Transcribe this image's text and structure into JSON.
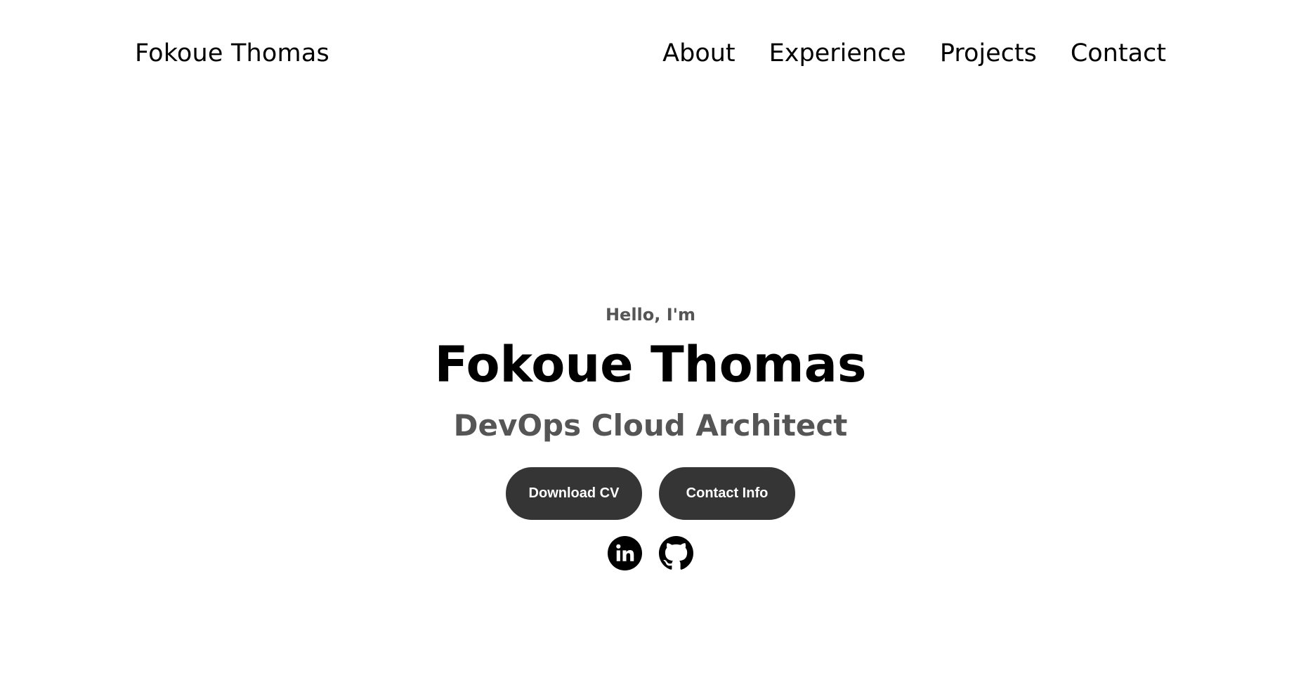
{
  "nav": {
    "logo": "Fokoue Thomas",
    "links": [
      "About",
      "Experience",
      "Projects",
      "Contact"
    ]
  },
  "hero": {
    "greeting": "Hello, I'm",
    "title": "Fokoue Thomas",
    "subtitle": "DevOps Cloud Architect",
    "buttons": {
      "download_cv": "Download CV",
      "contact_info": "Contact Info"
    },
    "socials": {
      "linkedin_icon": "linkedin-icon",
      "github_icon": "github-icon"
    }
  },
  "colors": {
    "background": "#ffffff",
    "text_primary": "#000000",
    "text_secondary": "#555555",
    "button_bg": "#353535",
    "button_text": "#ffffff"
  }
}
